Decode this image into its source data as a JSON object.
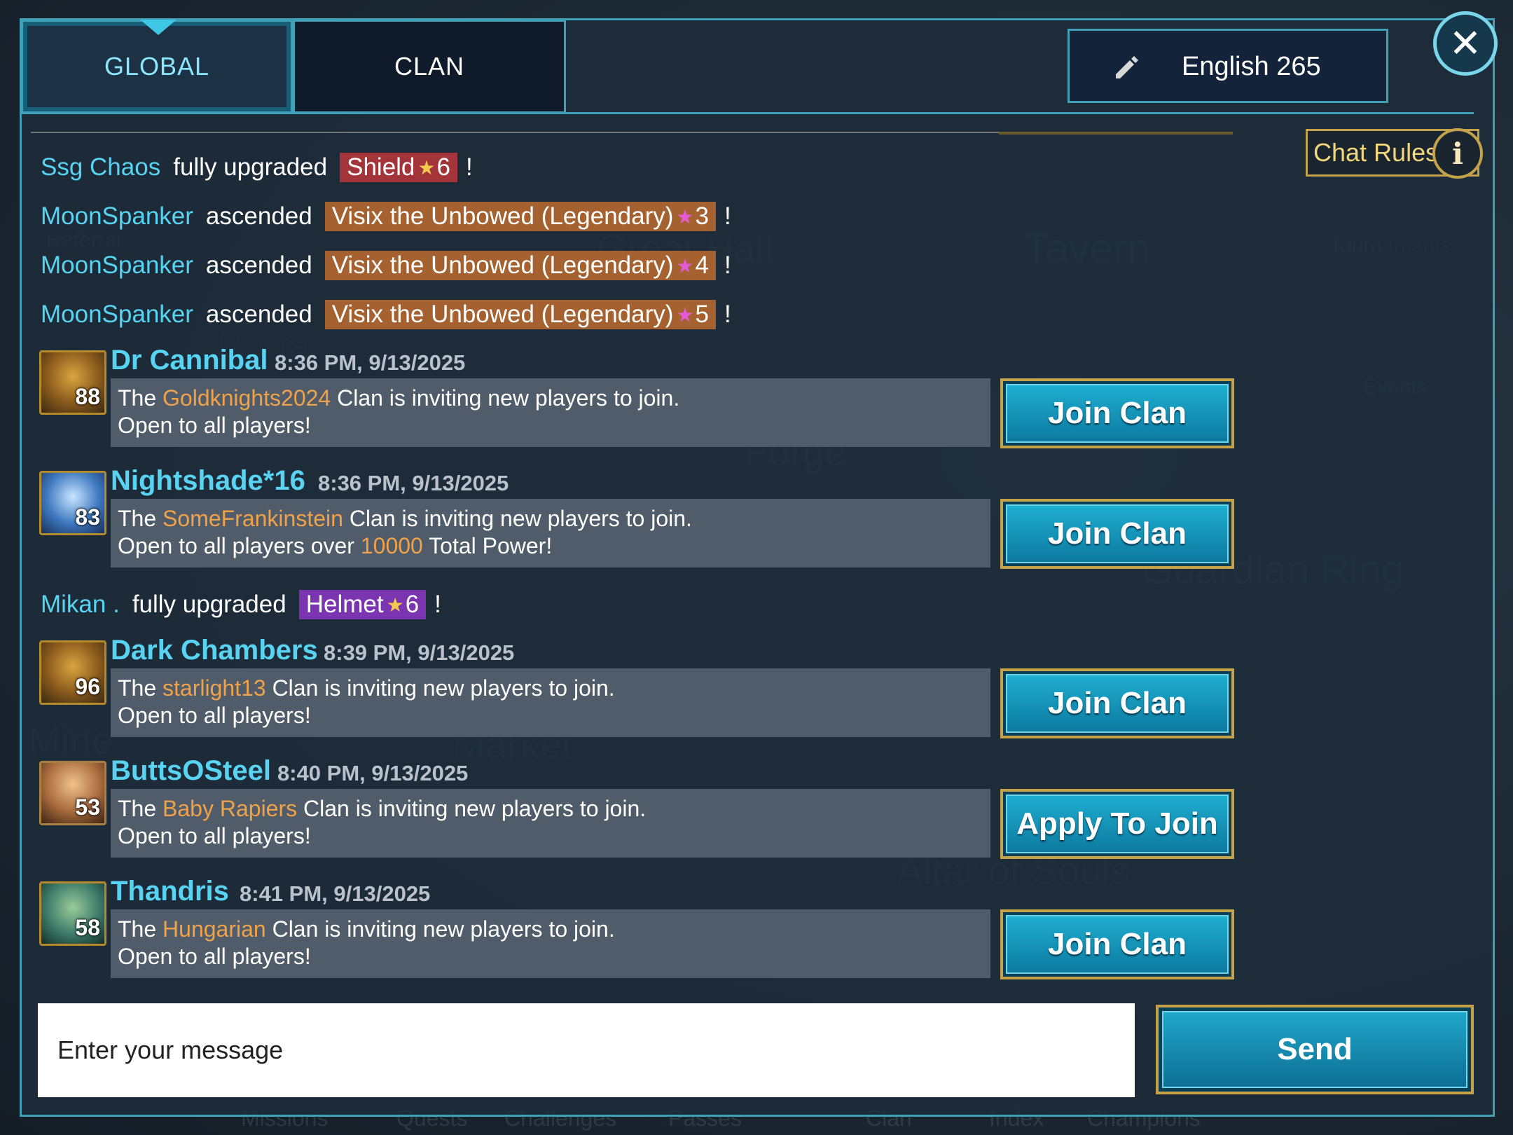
{
  "tabs": [
    {
      "label": "GLOBAL",
      "active": true
    },
    {
      "label": "CLAN",
      "active": false
    }
  ],
  "language": {
    "label": "English 265",
    "icon": "pencil-icon"
  },
  "close": {
    "icon": "close-icon",
    "symbol": "✕"
  },
  "chat_rules": {
    "label": "Chat Rules",
    "icon": "info-icon",
    "symbol": "i"
  },
  "system_messages": [
    {
      "who": "Ssg Chaos",
      "verb": "fully upgraded",
      "item": "Shield",
      "star": "★",
      "stars": "6",
      "color": "red"
    },
    {
      "who": "MoonSpanker",
      "verb": "ascended",
      "item": "Visix the Unbowed (Legendary)",
      "star": "★",
      "stars": "3",
      "color": "orange"
    },
    {
      "who": "MoonSpanker",
      "verb": "ascended",
      "item": "Visix the Unbowed (Legendary)",
      "star": "★",
      "stars": "4",
      "color": "orange"
    },
    {
      "who": "MoonSpanker",
      "verb": "ascended",
      "item": "Visix the Unbowed (Legendary)",
      "star": "★",
      "stars": "5",
      "color": "orange"
    },
    {
      "who": "Mikan .",
      "verb": "fully upgraded",
      "item": "Helmet",
      "star": "★",
      "stars": "6",
      "color": "purple"
    }
  ],
  "exclaim": "!",
  "messages": [
    {
      "name": "Dr Cannibal",
      "level": "88",
      "time": "8:36 PM, 9/13/2025",
      "pre": "The ",
      "clan": "Goldknights2024",
      "post": " Clan is inviting new players to join.",
      "line2_pre": "Open to all players!",
      "line2_hl": "",
      "line2_post": "",
      "button": "Join Clan"
    },
    {
      "name": "Nightshade*16",
      "level": "83",
      "time": "8:36 PM, 9/13/2025",
      "pre": "The ",
      "clan": "SomeFrankinstein",
      "post": " Clan is inviting new players to join.",
      "line2_pre": "Open to all players over ",
      "line2_hl": "10000",
      "line2_post": " Total Power!",
      "button": "Join Clan"
    },
    {
      "name": "Dark Chambers",
      "level": "96",
      "time": "8:39 PM, 9/13/2025",
      "pre": "The ",
      "clan": "starlight13",
      "post": " Clan is inviting new players to join.",
      "line2_pre": "Open to all players!",
      "line2_hl": "",
      "line2_post": "",
      "button": "Join Clan"
    },
    {
      "name": "ButtsOSteel",
      "level": "53",
      "time": "8:40 PM, 9/13/2025",
      "pre": "The ",
      "clan": "Baby Rapiers",
      "post": " Clan is inviting new players to join.",
      "line2_pre": "Open to all players!",
      "line2_hl": "",
      "line2_post": "",
      "button": "Apply To Join"
    },
    {
      "name": "Thandris",
      "level": "58",
      "time": "8:41 PM, 9/13/2025",
      "pre": "The ",
      "clan": "Hungarian",
      "post": " Clan is inviting new players to join.",
      "line2_pre": "Open to all players!",
      "line2_hl": "",
      "line2_post": "",
      "button": "Join Clan"
    }
  ],
  "composer": {
    "placeholder": "Enter your message",
    "send_label": "Send"
  },
  "background_labels": [
    "Tavern",
    "Great Hall",
    "Portal",
    "Forge",
    "Guardian Ring",
    "Market",
    "Mine",
    "Altar of Souls",
    "Referral",
    "Tournaments",
    "Events",
    "Missions",
    "Quests",
    "Challenges",
    "Passes",
    "Clan",
    "Index",
    "Champions"
  ],
  "colors": {
    "accent": "#58d3f2",
    "clan_name": "#f0a24a",
    "button": "#1eaed0",
    "gold_border": "#c3a24a"
  }
}
